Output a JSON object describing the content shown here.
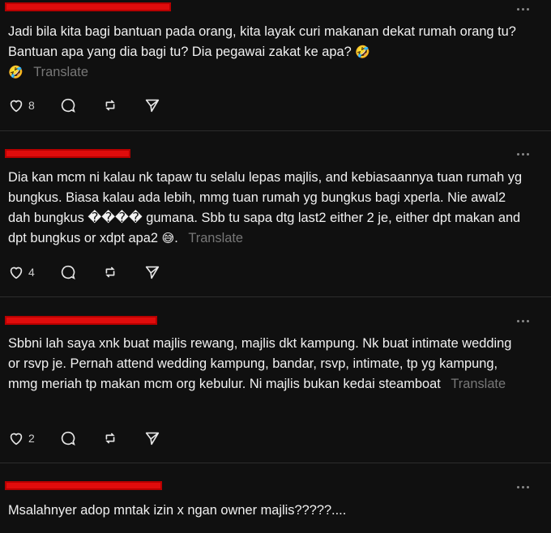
{
  "posts": [
    {
      "text": "Jadi bila kita bagi bantuan pada orang, kita layak curi makanan dekat rumah orang tu? Bantuan apa yang dia bagi tu? Dia pegawai zakat ke apa?",
      "emoji": "🤣",
      "emoji_line2": "🤣",
      "translate": "Translate",
      "likes": "8"
    },
    {
      "text": "Dia kan mcm ni kalau nk tapaw tu selalu lepas majlis, and kebiasaannya tuan rumah yg bungkus. Biasa kalau ada lebih, mmg tuan rumah yg bungkus bagi xperla. Nie awal2 dah bungkus ���� gumana. Sbb tu sapa dtg last2 either 2 je, either dpt makan and dpt bungkus or xdpt apa2",
      "emoji": "😅",
      "after_emoji": ".",
      "translate": "Translate",
      "likes": "4"
    },
    {
      "text": "Sbbni lah saya xnk buat majlis rewang, majlis dkt kampung. Nk buat intimate wedding or rsvp je. Pernah attend wedding kampung, bandar, rsvp, intimate, tp yg kampung, mmg meriah tp makan mcm org kebulur. Ni majlis bukan kedai steamboat",
      "translate": "Translate",
      "likes": "2"
    },
    {
      "text": "Msalahnyer adop mntak izin x ngan owner majlis?????...."
    }
  ],
  "icons": [
    "heart-icon",
    "comment-icon",
    "repost-icon",
    "share-icon",
    "more-icon"
  ]
}
